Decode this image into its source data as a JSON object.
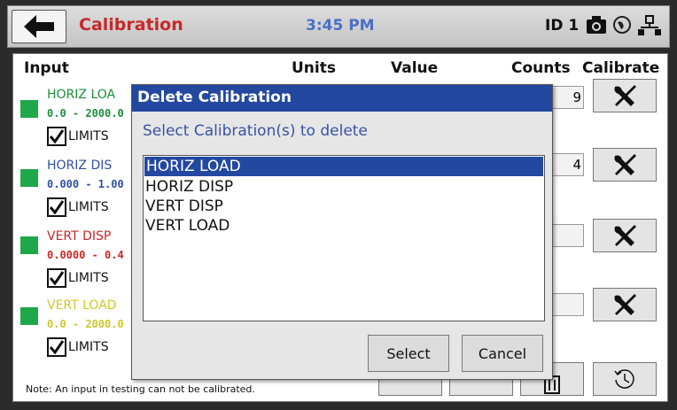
{
  "header": {
    "title": "Calibration",
    "time": "3:45 PM",
    "id_label": "ID 1"
  },
  "columns": {
    "input": "Input",
    "units": "Units",
    "value": "Value",
    "counts": "Counts",
    "calibrate": "Calibrate"
  },
  "channels": [
    {
      "name": "HORIZ LOA",
      "range": "0.0 - 2000.0",
      "limits": "LIMITS",
      "color": "#1a8f3c",
      "counts_partial": "9"
    },
    {
      "name": "HORIZ DIS",
      "range": "0.000 - 1.00",
      "limits": "LIMITS",
      "color": "#2f4fa0",
      "counts_partial": "4"
    },
    {
      "name": "VERT DISP",
      "range": "0.0000 - 0.4",
      "limits": "LIMITS",
      "color": "#c8282a",
      "counts_partial": ""
    },
    {
      "name": "VERT LOAD",
      "range": "0.0 - 2000.0",
      "limits": "LIMITS",
      "color": "#cfc828",
      "counts_partial": ""
    }
  ],
  "note": "Note: An input in testing can not be calibrated.",
  "dialog": {
    "title": "Delete Calibration",
    "prompt": "Select Calibration(s) to delete",
    "items": [
      "HORIZ LOAD",
      "HORIZ DISP",
      "VERT DISP",
      "VERT LOAD"
    ],
    "selected_index": 0,
    "select_label": "Select",
    "cancel_label": "Cancel"
  },
  "icons": {
    "back": "back-arrow-icon",
    "camera": "camera-icon",
    "globe": "globe-icon",
    "network": "network-icon",
    "wrench": "wrench-screwdriver-icon",
    "history": "history-icon",
    "trash": "trash-icon"
  },
  "colors": {
    "title_red": "#c8282a",
    "clock_blue": "#4a6fc6",
    "dialog_blue": "#2348a0",
    "swatch_green": "#1fa84a"
  }
}
